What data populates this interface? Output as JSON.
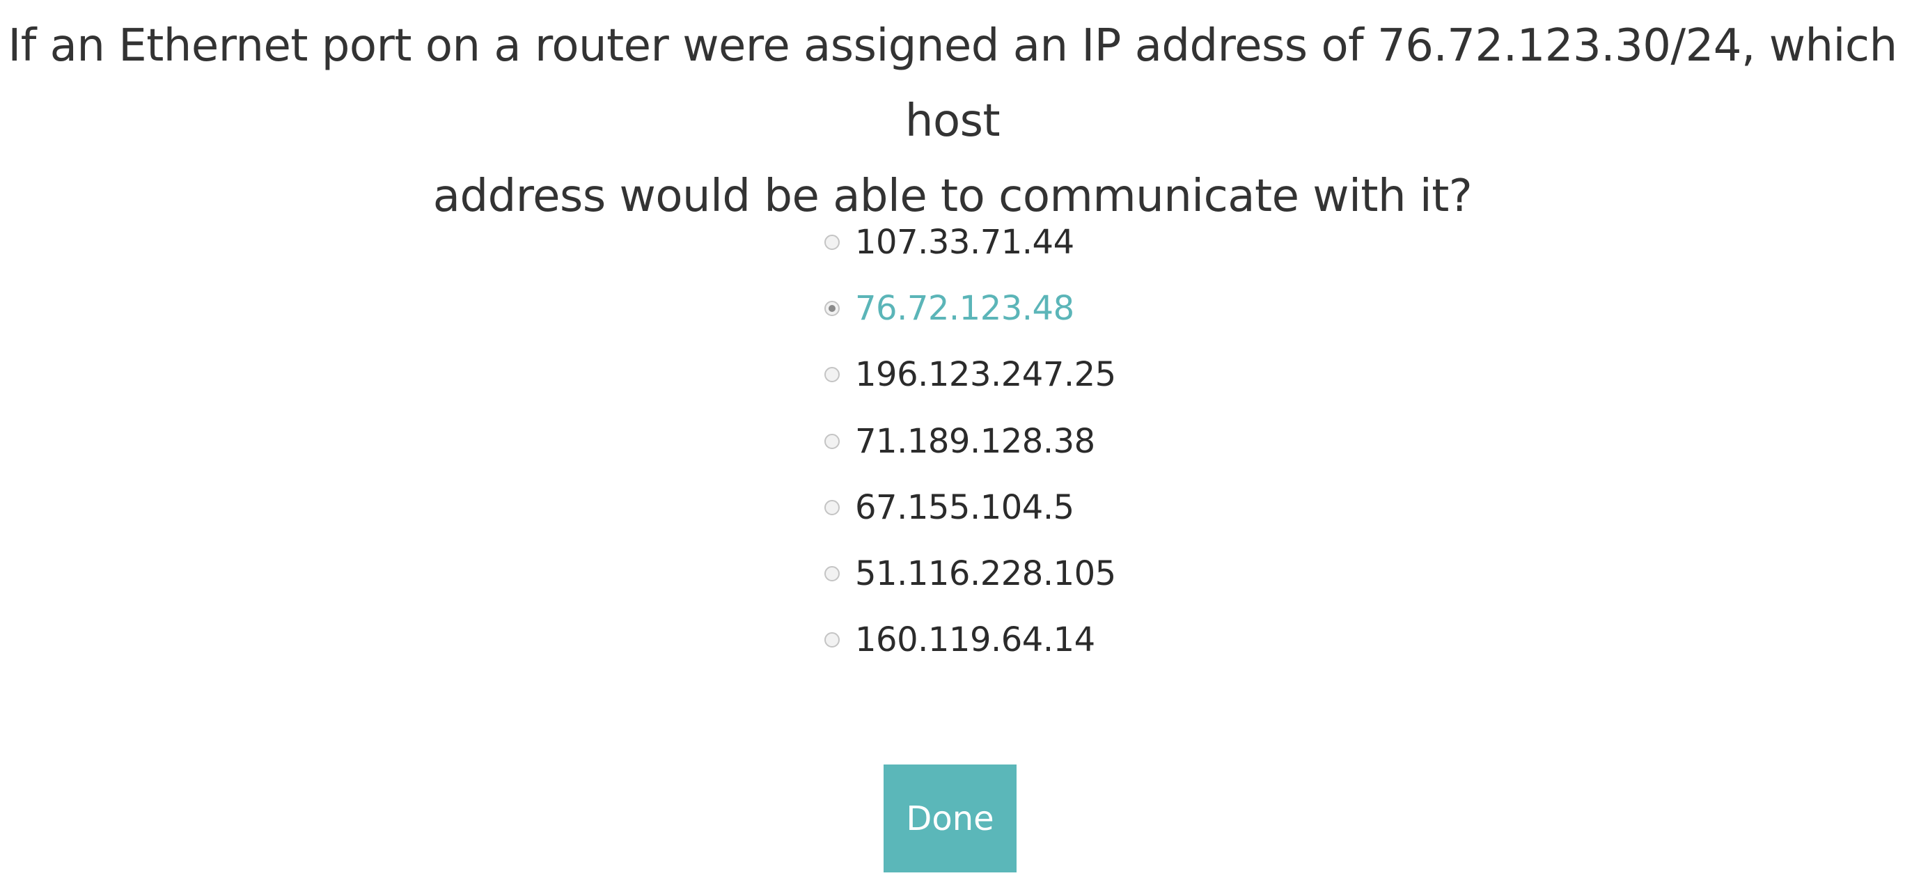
{
  "question": {
    "line1": "If an Ethernet port on a router were assigned an IP address of 76.72.123.30/24, which host",
    "line2": "address would be able to communicate with it?"
  },
  "options": [
    {
      "label": "107.33.71.44",
      "selected": false
    },
    {
      "label": "76.72.123.48",
      "selected": true
    },
    {
      "label": "196.123.247.25",
      "selected": false
    },
    {
      "label": "71.189.128.38",
      "selected": false
    },
    {
      "label": "67.155.104.5",
      "selected": false
    },
    {
      "label": "51.116.228.105",
      "selected": false
    },
    {
      "label": "160.119.64.14",
      "selected": false
    }
  ],
  "done_button": {
    "label": "Done"
  },
  "colors": {
    "accent": "#5bb7b9",
    "selected_text": "#5bb5b8",
    "text": "#333333"
  }
}
